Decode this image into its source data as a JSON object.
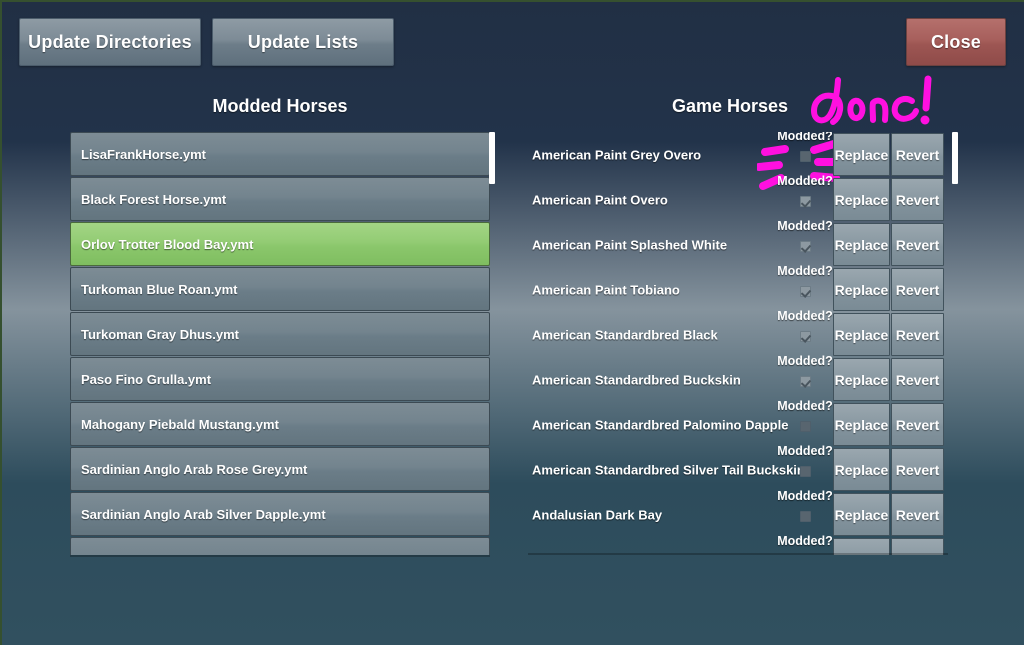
{
  "window": {
    "accent_green": "#8fcc70",
    "annotation_color": "#ff10e0",
    "close_color": "#a75f5c"
  },
  "toolbar": {
    "update_directories_label": "Update Directories",
    "update_lists_label": "Update Lists",
    "close_label": "Close"
  },
  "headers": {
    "modded_title": "Modded Horses",
    "game_title": "Game Horses"
  },
  "annotations": {
    "done_text": "done!",
    "arrow_target": "modded-checkbox-row-1"
  },
  "modded_list": {
    "selected_index": 2,
    "items": [
      {
        "name": "LisaFrankHorse.ymt"
      },
      {
        "name": "Black Forest Horse.ymt"
      },
      {
        "name": "Orlov Trotter Blood Bay.ymt"
      },
      {
        "name": "Turkoman Blue Roan.ymt"
      },
      {
        "name": "Turkoman Gray Dhus.ymt"
      },
      {
        "name": "Paso Fino Grulla.ymt"
      },
      {
        "name": "Mahogany Piebald Mustang.ymt"
      },
      {
        "name": "Sardinian Anglo Arab Rose Grey.ymt"
      },
      {
        "name": "Sardinian Anglo Arab Silver Dapple.ymt"
      },
      {
        "name": ""
      }
    ]
  },
  "game_list": {
    "modded_label": "Modded?",
    "replace_label": "Replace",
    "revert_label": "Revert",
    "items": [
      {
        "name": "American Paint Grey Overo",
        "modded": false
      },
      {
        "name": "American Paint Overo",
        "modded": true
      },
      {
        "name": "American Paint Splashed White",
        "modded": true
      },
      {
        "name": "American Paint Tobiano",
        "modded": true
      },
      {
        "name": "American Standardbred Black",
        "modded": true
      },
      {
        "name": "American Standardbred Buckskin",
        "modded": true
      },
      {
        "name": "American Standardbred Palomino Dapple",
        "modded": false
      },
      {
        "name": "American Standardbred Silver Tail Buckskin",
        "modded": false
      },
      {
        "name": "Andalusian Dark Bay",
        "modded": false
      },
      {
        "name": "",
        "modded": false
      }
    ]
  }
}
